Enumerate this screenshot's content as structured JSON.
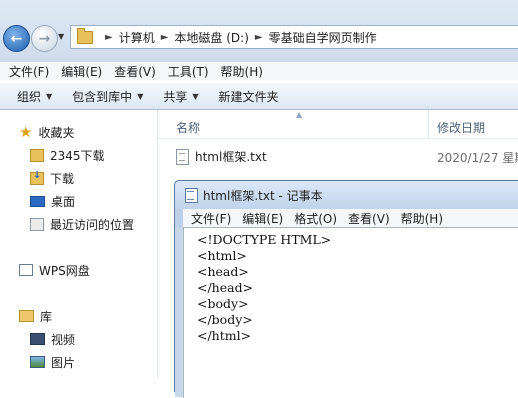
{
  "address": {
    "crumbs": [
      "计算机",
      "本地磁盘 (D:)",
      "零基础自学网页制作"
    ]
  },
  "menubar": {
    "items": [
      "文件(F)",
      "编辑(E)",
      "查看(V)",
      "工具(T)",
      "帮助(H)"
    ]
  },
  "toolbar": {
    "organize": "组织",
    "include_library": "包含到库中",
    "share": "共享",
    "new_folder": "新建文件夹"
  },
  "navpane": {
    "favorites": "收藏夹",
    "fav_items": [
      "2345下载",
      "下载",
      "桌面",
      "最近访问的位置"
    ],
    "wps": "WPS网盘",
    "library": "库",
    "lib_items": [
      "视频",
      "图片"
    ]
  },
  "filelist": {
    "col_name": "名称",
    "col_date": "修改日期",
    "files": [
      {
        "name": "html框架.txt",
        "date": "2020/1/27 星期"
      }
    ]
  },
  "notepad": {
    "title": "html框架.txt - 记事本",
    "menu": [
      "文件(F)",
      "编辑(E)",
      "格式(O)",
      "查看(V)",
      "帮助(H)"
    ],
    "lines": [
      "<!DOCTYPE HTML>",
      "<html>",
      "<head>",
      "</head>",
      "<body>",
      "</body>",
      "</html>"
    ]
  },
  "colors": {
    "accent": "#1f5fae",
    "window_frame": "#bcd0e8"
  }
}
